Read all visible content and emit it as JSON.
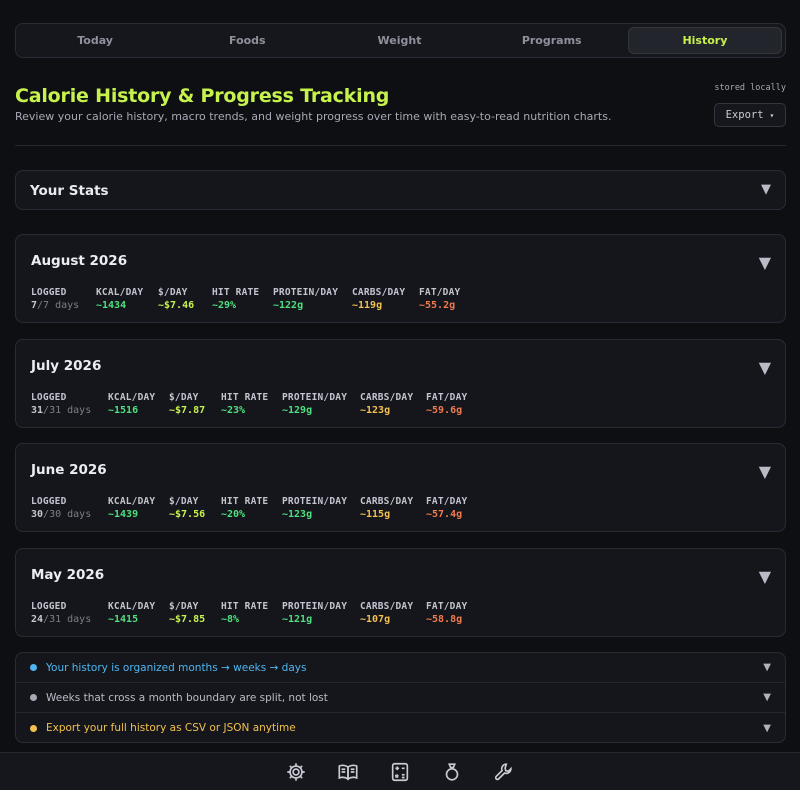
{
  "tabs": [
    {
      "label": "Today"
    },
    {
      "label": "Foods"
    },
    {
      "label": "Weight"
    },
    {
      "label": "Programs"
    },
    {
      "label": "History"
    }
  ],
  "header": {
    "title": "Calorie History & Progress Tracking",
    "subtitle": "Review your calorie history, macro trends, and weight progress over time with easy-to-read nutrition charts.",
    "stored": "stored locally",
    "export_label": "Export",
    "export_caret": "▾"
  },
  "stats": {
    "label": "Your Stats",
    "caret": "▼"
  },
  "metric_labels": [
    "LOGGED",
    "KCAL/DAY",
    "$/DAY",
    "HIT RATE",
    "PROTEIN/DAY",
    "CARBS/DAY",
    "FAT/DAY"
  ],
  "months": [
    {
      "title": "August 2026",
      "logged_num": "7",
      "logged_den": "/7 days",
      "kcal": "~1434",
      "cost": "~$7.46",
      "hit": "~29%",
      "protein": "~122g",
      "carbs": "~119g",
      "fat": "~55.2g"
    },
    {
      "title": "July 2026",
      "logged_num": "31",
      "logged_den": "/31 days",
      "kcal": "~1516",
      "cost": "~$7.87",
      "hit": "~23%",
      "protein": "~129g",
      "carbs": "~123g",
      "fat": "~59.6g"
    },
    {
      "title": "June 2026",
      "logged_num": "30",
      "logged_den": "/30 days",
      "kcal": "~1439",
      "cost": "~$7.56",
      "hit": "~20%",
      "protein": "~123g",
      "carbs": "~115g",
      "fat": "~57.4g"
    },
    {
      "title": "May 2026",
      "logged_num": "24",
      "logged_den": "/31 days",
      "kcal": "~1415",
      "cost": "~$7.85",
      "hit": "~8%",
      "protein": "~121g",
      "carbs": "~107g",
      "fat": "~58.8g"
    }
  ],
  "tips": [
    {
      "text": "Your history is organized months → weeks → days",
      "color": "#4fb6f0"
    },
    {
      "text": "Weeks that cross a month boundary are split, not lost",
      "color": "#a7a9b4"
    },
    {
      "text": "Export your full history as CSV or JSON anytime",
      "color": "#f2c14e"
    }
  ],
  "colors": {
    "accent": "#c6f24e",
    "kcal": "#4ee07e",
    "cost": "#c6f24e",
    "hit": "#4ee07e",
    "protein": "#4ee07e",
    "carbs": "#f2c14e",
    "fat": "#f27a4e"
  },
  "bottom_icons": [
    "gear-icon",
    "book-icon",
    "calculator-icon",
    "ring-icon",
    "wrench-icon"
  ]
}
